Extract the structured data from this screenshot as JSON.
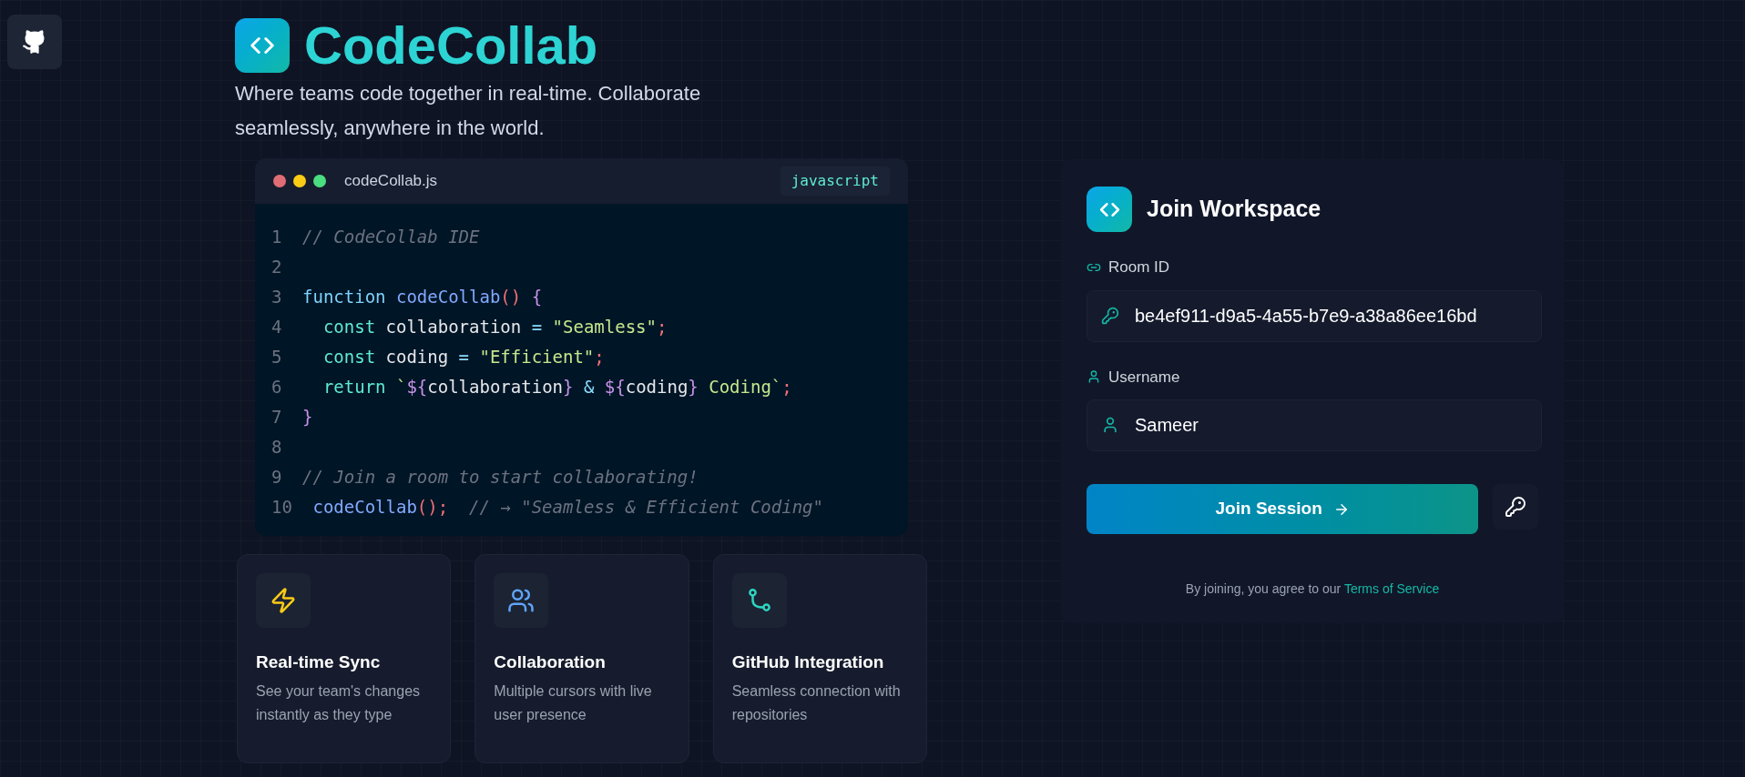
{
  "brand": {
    "title": "CodeCollab",
    "tagline": "Where teams code together in real-time. Collaborate seamlessly, anywhere in the world."
  },
  "editor": {
    "filename": "codeCollab.js",
    "language": "javascript",
    "lines": [
      {
        "number": "1",
        "tokens": [
          {
            "kind": "comment",
            "text": "// CodeCollab IDE"
          }
        ]
      },
      {
        "number": "2"
      },
      {
        "number": "3",
        "tokens": [
          {
            "kind": "keyword",
            "text": "function "
          },
          {
            "kind": "fn",
            "text": "codeCollab"
          },
          {
            "kind": "punct",
            "text": "() "
          },
          {
            "kind": "brace",
            "text": "{"
          }
        ]
      },
      {
        "number": "4",
        "tokens": [
          {
            "kind": "decl",
            "text": "  const "
          },
          {
            "kind": "plain",
            "text": "collaboration "
          },
          {
            "kind": "op",
            "text": "= "
          },
          {
            "kind": "string",
            "text": "\"Seamless\""
          },
          {
            "kind": "punct",
            "text": ";"
          }
        ]
      },
      {
        "number": "5",
        "tokens": [
          {
            "kind": "decl",
            "text": "  const "
          },
          {
            "kind": "plain",
            "text": "coding "
          },
          {
            "kind": "op",
            "text": "= "
          },
          {
            "kind": "string",
            "text": "\"Efficient\""
          },
          {
            "kind": "punct",
            "text": ";"
          }
        ]
      },
      {
        "number": "6",
        "tokens": [
          {
            "kind": "decl",
            "text": "  return "
          },
          {
            "kind": "string",
            "text": "`"
          },
          {
            "kind": "brace",
            "text": "${"
          },
          {
            "kind": "plain",
            "text": "collaboration"
          },
          {
            "kind": "brace",
            "text": "}"
          },
          {
            "kind": "op",
            "text": " & "
          },
          {
            "kind": "brace",
            "text": "${"
          },
          {
            "kind": "plain",
            "text": "coding"
          },
          {
            "kind": "brace",
            "text": "}"
          },
          {
            "kind": "string",
            "text": " Coding`"
          },
          {
            "kind": "punct",
            "text": ";"
          }
        ]
      },
      {
        "number": "7",
        "tokens": [
          {
            "kind": "brace",
            "text": "}"
          }
        ]
      },
      {
        "number": "8"
      },
      {
        "number": "9",
        "tokens": [
          {
            "kind": "comment",
            "text": "// Join a room to start collaborating!"
          }
        ]
      },
      {
        "number": "10",
        "tokens": [
          {
            "kind": "fn",
            "text": " codeCollab"
          },
          {
            "kind": "punct",
            "text": "();  "
          },
          {
            "kind": "comment",
            "text": "// → \"Seamless & Efficient Coding\""
          }
        ]
      }
    ]
  },
  "features": [
    {
      "kind": "bolt",
      "color": "#facc15",
      "title": "Real-time Sync",
      "description": "See your team's changes instantly as they type"
    },
    {
      "kind": "users",
      "color": "#60a5fa",
      "title": "Collaboration",
      "description": "Multiple cursors with live user presence"
    },
    {
      "kind": "branch",
      "color": "#2dd4bf",
      "title": "GitHub Integration",
      "description": "Seamless connection with repositories"
    }
  ],
  "join_panel": {
    "title": "Join Workspace",
    "fields": [
      {
        "kind": "room",
        "label": "Room ID",
        "value": "be4ef911-d9a5-4a55-b7e9-a38a86ee16bd"
      },
      {
        "kind": "user",
        "label": "Username",
        "value": "Sameer"
      }
    ],
    "submit": "Join Session",
    "terms": {
      "text": "By joining, you agree to our",
      "link": "Terms of Service"
    }
  }
}
